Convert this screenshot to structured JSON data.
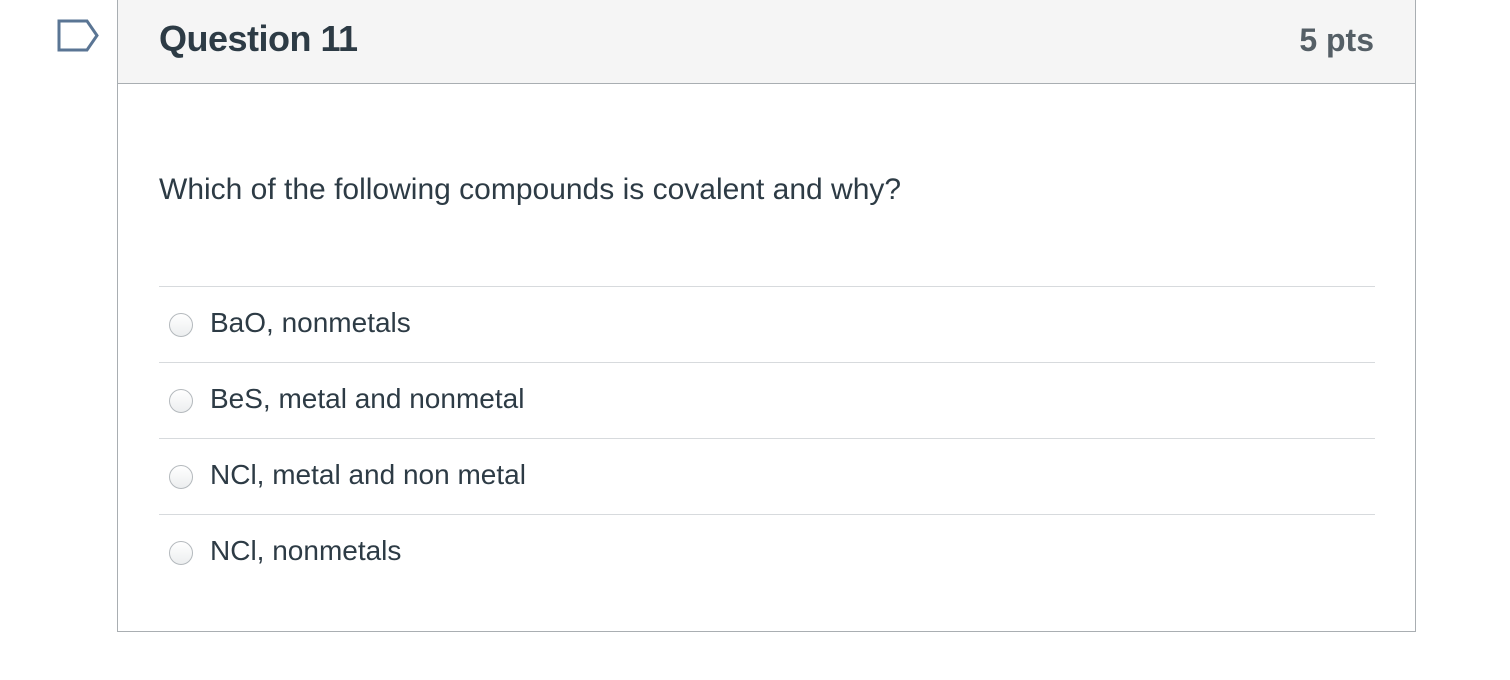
{
  "question": {
    "title": "Question 11",
    "points": "5 pts",
    "text": "Which of the following compounds is covalent and why?",
    "flag_icon": "flag-question-icon",
    "answers": [
      {
        "label": "BaO, nonmetals",
        "selected": false
      },
      {
        "label": "BeS, metal and nonmetal",
        "selected": false
      },
      {
        "label": "NCl, metal and non metal",
        "selected": false
      },
      {
        "label": "NCl, nonmetals",
        "selected": false
      }
    ]
  },
  "colors": {
    "text": "#2d3b45",
    "header_bg": "#f5f5f5",
    "border": "#a9aeb2",
    "flag": "#5a7594"
  }
}
